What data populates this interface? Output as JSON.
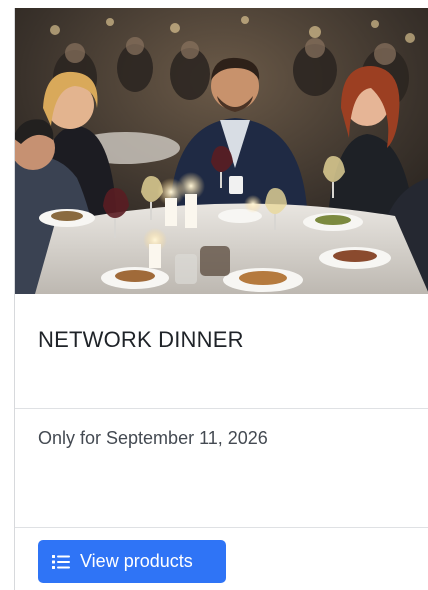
{
  "card": {
    "image": {
      "subject": "people networking at a candlelit dinner table"
    },
    "title": "NETWORK DINNER",
    "date_text": "Only for September 11, 2026",
    "cta": {
      "label": "View products",
      "icon": "list-icon"
    }
  },
  "colors": {
    "button": "#2f74f6",
    "title": "#1f2328",
    "body_text": "#444a52",
    "divider": "#dfe1e4"
  }
}
